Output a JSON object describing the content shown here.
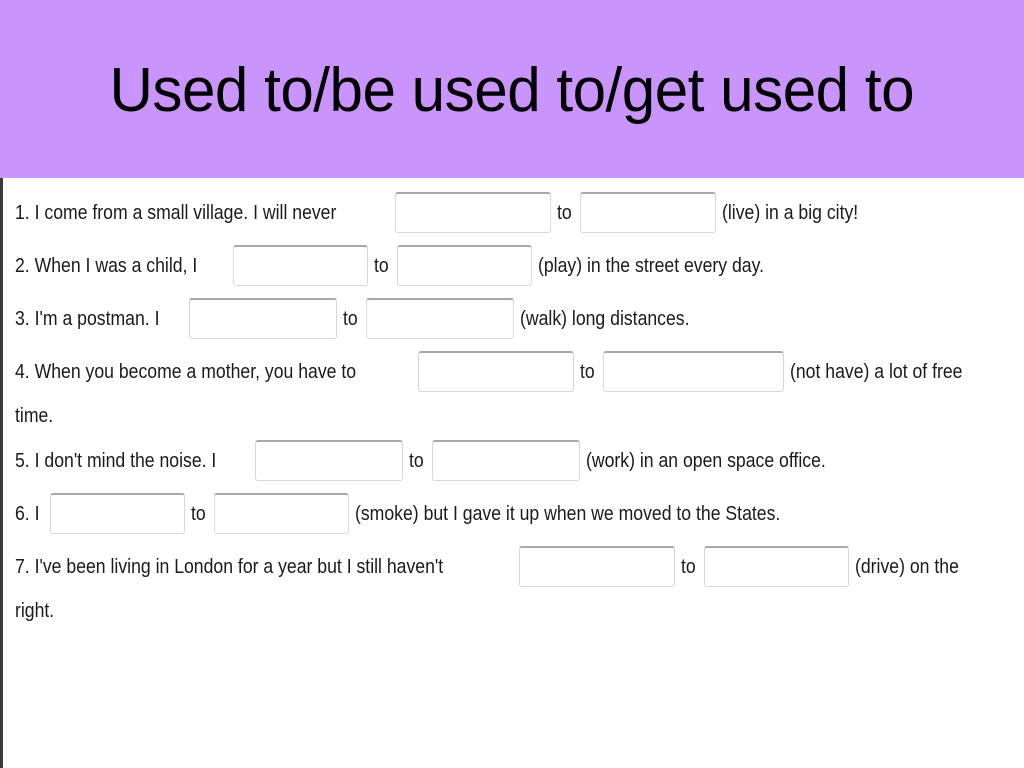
{
  "slide": {
    "title": "Used to/be used to/get used to",
    "banner_color": "#c994fc",
    "text_color": "#1a1a1a",
    "blank_border_color": "#d8d8d8",
    "blank_border_top_color": "#a8a8a8"
  },
  "connector": "to",
  "exercises": [
    {
      "number": "1.",
      "before": "1. I come from a small village. I will never",
      "blank1_width": 156,
      "blank2_width": 136,
      "after": "(live) in a big city!",
      "verb": "(live)"
    },
    {
      "number": "2.",
      "before": "2. When I was a child, I",
      "blank1_width": 135,
      "blank2_width": 135,
      "after": "(play) in the street every day.",
      "verb": "(play)"
    },
    {
      "number": "3.",
      "before": "3. I'm a postman. I",
      "blank1_width": 148,
      "blank2_width": 148,
      "after": "(walk) long distances.",
      "verb": "(walk)"
    },
    {
      "number": "4.",
      "before": "4. When you become a mother, you have to",
      "blank1_width": 156,
      "blank2_width": 181,
      "after": "(not have) a lot of free",
      "wrap": "time.",
      "verb": "(not have)"
    },
    {
      "number": "5.",
      "before": "5. I don't mind the noise. I",
      "blank1_width": 148,
      "blank2_width": 148,
      "after": "(work) in an open space office.",
      "verb": "(work)"
    },
    {
      "number": "6.",
      "before": "6. I",
      "blank1_width": 135,
      "blank2_width": 135,
      "after": "(smoke) but I gave it up when we moved to the States.",
      "verb": "(smoke)"
    },
    {
      "number": "7.",
      "before": "7. I've been living in London for a year but I still haven't",
      "blank1_width": 156,
      "blank2_width": 145,
      "after": "(drive) on the",
      "wrap": "right.",
      "verb": "(drive)"
    }
  ]
}
